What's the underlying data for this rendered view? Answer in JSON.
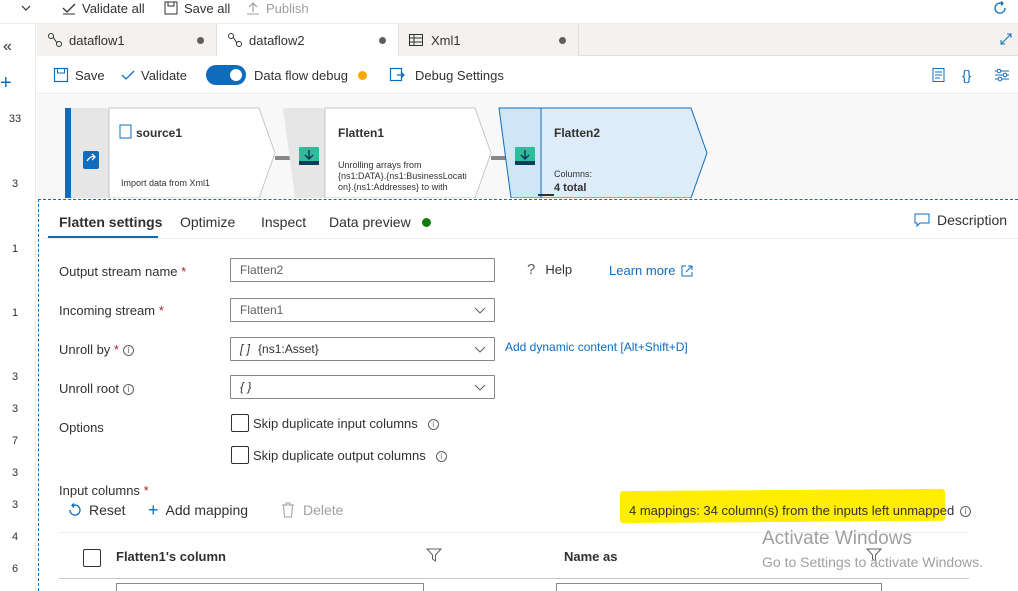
{
  "topbar": {
    "validate_all": "Validate all",
    "save_all": "Save all",
    "publish": "Publish"
  },
  "rail": {
    "numbers": [
      "33",
      "3",
      "1",
      "1",
      "3",
      "3",
      "7",
      "3",
      "3",
      "4",
      "6"
    ]
  },
  "tabs": [
    {
      "label": "dataflow1",
      "active": false
    },
    {
      "label": "dataflow2",
      "active": true
    },
    {
      "label": "Xml1",
      "active": false
    }
  ],
  "toolbar": {
    "save": "Save",
    "validate": "Validate",
    "debug_label": "Data flow debug",
    "debug_settings": "Debug Settings"
  },
  "canvas": {
    "nodes": [
      {
        "title": "source1",
        "text": "Import data from Xml1"
      },
      {
        "title": "Flatten1",
        "text_lines": [
          "Unrolling arrays from",
          "{ns1:DATA}.{ns1:BusinessLocati",
          "on}.{ns1:Addresses} to  with"
        ]
      },
      {
        "title": "Flatten2",
        "columns_label": "Columns:",
        "columns_value": "4 total"
      }
    ]
  },
  "panel": {
    "tabs": [
      "Flatten settings",
      "Optimize",
      "Inspect",
      "Data preview"
    ],
    "description": "Description",
    "output_stream_name_label": "Output stream name",
    "output_stream_name_value": "Flatten2",
    "help": "Help",
    "learn_more": "Learn more",
    "incoming_stream_label": "Incoming stream",
    "incoming_stream_value": "Flatten1",
    "unroll_by_label": "Unroll by",
    "unroll_by_value": "{ns1:Asset}",
    "unroll_by_prefix": "[ ]",
    "add_dynamic": "Add dynamic content [Alt+Shift+D]",
    "unroll_root_label": "Unroll root",
    "unroll_root_value": "{ }",
    "options_label": "Options",
    "skip_input": "Skip duplicate input columns",
    "skip_output": "Skip duplicate output columns",
    "input_columns_label": "Input columns",
    "reset": "Reset",
    "add_mapping": "Add mapping",
    "delete": "Delete",
    "mappings_status": "4 mappings: 34 column(s) from the inputs left unmapped",
    "col_header_1": "Flatten1's column",
    "col_header_2": "Name as"
  },
  "watermark": {
    "line1": "Activate Windows",
    "line2": "Go to Settings to activate Windows."
  },
  "colors": {
    "accent": "#0f6cbd",
    "debug_dot": "#f7a700",
    "preview_dot": "#107c10",
    "highlight": "#ffee00"
  }
}
